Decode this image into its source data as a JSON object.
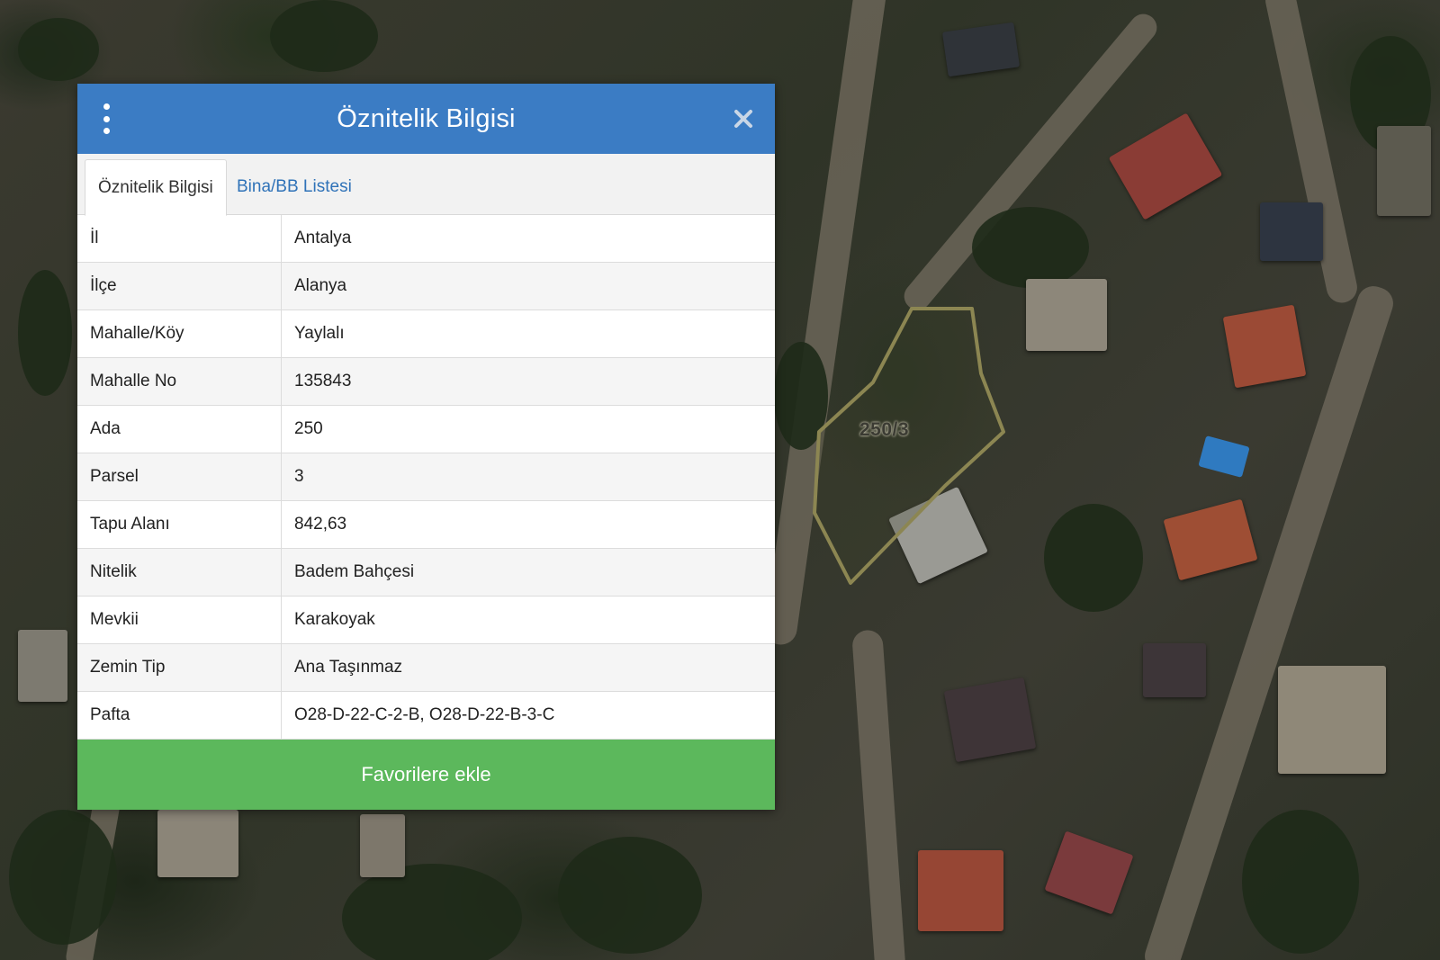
{
  "map": {
    "parcel_label": "250/3"
  },
  "panel": {
    "title": "Öznitelik Bilgisi",
    "menu_icon": "vertical-dots-icon",
    "close_icon": "close-icon",
    "tabs": [
      {
        "label": "Öznitelik Bilgisi",
        "active": true
      },
      {
        "label": "Bina/BB Listesi",
        "active": false
      }
    ],
    "rows": [
      {
        "key": "İl",
        "value": "Antalya"
      },
      {
        "key": "İlçe",
        "value": "Alanya"
      },
      {
        "key": "Mahalle/Köy",
        "value": "Yaylalı"
      },
      {
        "key": "Mahalle No",
        "value": "135843"
      },
      {
        "key": "Ada",
        "value": "250"
      },
      {
        "key": "Parsel",
        "value": "3"
      },
      {
        "key": "Tapu Alanı",
        "value": "842,63"
      },
      {
        "key": "Nitelik",
        "value": "Badem Bahçesi"
      },
      {
        "key": "Mevkii",
        "value": "Karakoyak"
      },
      {
        "key": "Zemin Tip",
        "value": "Ana Taşınmaz"
      },
      {
        "key": "Pafta",
        "value": "O28-D-22-C-2-B, O28-D-22-B-3-C"
      }
    ],
    "favorite_button": "Favorilere ekle"
  },
  "colors": {
    "header": "#3b7cc4",
    "favorite_button": "#5cb85c",
    "tab_link": "#2f72b8",
    "parcel_outline": "#8c8652"
  }
}
